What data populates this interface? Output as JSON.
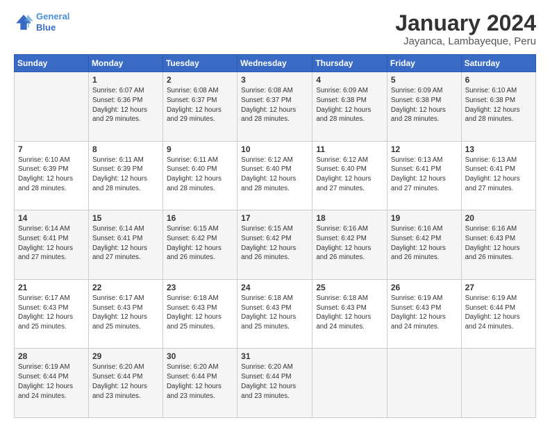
{
  "header": {
    "logo_line1": "General",
    "logo_line2": "Blue",
    "title": "January 2024",
    "subtitle": "Jayanca, Lambayeque, Peru"
  },
  "days_of_week": [
    "Sunday",
    "Monday",
    "Tuesday",
    "Wednesday",
    "Thursday",
    "Friday",
    "Saturday"
  ],
  "weeks": [
    [
      {
        "day": "",
        "info": ""
      },
      {
        "day": "1",
        "info": "Sunrise: 6:07 AM\nSunset: 6:36 PM\nDaylight: 12 hours\nand 29 minutes."
      },
      {
        "day": "2",
        "info": "Sunrise: 6:08 AM\nSunset: 6:37 PM\nDaylight: 12 hours\nand 29 minutes."
      },
      {
        "day": "3",
        "info": "Sunrise: 6:08 AM\nSunset: 6:37 PM\nDaylight: 12 hours\nand 28 minutes."
      },
      {
        "day": "4",
        "info": "Sunrise: 6:09 AM\nSunset: 6:38 PM\nDaylight: 12 hours\nand 28 minutes."
      },
      {
        "day": "5",
        "info": "Sunrise: 6:09 AM\nSunset: 6:38 PM\nDaylight: 12 hours\nand 28 minutes."
      },
      {
        "day": "6",
        "info": "Sunrise: 6:10 AM\nSunset: 6:38 PM\nDaylight: 12 hours\nand 28 minutes."
      }
    ],
    [
      {
        "day": "7",
        "info": "Sunrise: 6:10 AM\nSunset: 6:39 PM\nDaylight: 12 hours\nand 28 minutes."
      },
      {
        "day": "8",
        "info": "Sunrise: 6:11 AM\nSunset: 6:39 PM\nDaylight: 12 hours\nand 28 minutes."
      },
      {
        "day": "9",
        "info": "Sunrise: 6:11 AM\nSunset: 6:40 PM\nDaylight: 12 hours\nand 28 minutes."
      },
      {
        "day": "10",
        "info": "Sunrise: 6:12 AM\nSunset: 6:40 PM\nDaylight: 12 hours\nand 28 minutes."
      },
      {
        "day": "11",
        "info": "Sunrise: 6:12 AM\nSunset: 6:40 PM\nDaylight: 12 hours\nand 27 minutes."
      },
      {
        "day": "12",
        "info": "Sunrise: 6:13 AM\nSunset: 6:41 PM\nDaylight: 12 hours\nand 27 minutes."
      },
      {
        "day": "13",
        "info": "Sunrise: 6:13 AM\nSunset: 6:41 PM\nDaylight: 12 hours\nand 27 minutes."
      }
    ],
    [
      {
        "day": "14",
        "info": "Sunrise: 6:14 AM\nSunset: 6:41 PM\nDaylight: 12 hours\nand 27 minutes."
      },
      {
        "day": "15",
        "info": "Sunrise: 6:14 AM\nSunset: 6:41 PM\nDaylight: 12 hours\nand 27 minutes."
      },
      {
        "day": "16",
        "info": "Sunrise: 6:15 AM\nSunset: 6:42 PM\nDaylight: 12 hours\nand 26 minutes."
      },
      {
        "day": "17",
        "info": "Sunrise: 6:15 AM\nSunset: 6:42 PM\nDaylight: 12 hours\nand 26 minutes."
      },
      {
        "day": "18",
        "info": "Sunrise: 6:16 AM\nSunset: 6:42 PM\nDaylight: 12 hours\nand 26 minutes."
      },
      {
        "day": "19",
        "info": "Sunrise: 6:16 AM\nSunset: 6:42 PM\nDaylight: 12 hours\nand 26 minutes."
      },
      {
        "day": "20",
        "info": "Sunrise: 6:16 AM\nSunset: 6:43 PM\nDaylight: 12 hours\nand 26 minutes."
      }
    ],
    [
      {
        "day": "21",
        "info": "Sunrise: 6:17 AM\nSunset: 6:43 PM\nDaylight: 12 hours\nand 25 minutes."
      },
      {
        "day": "22",
        "info": "Sunrise: 6:17 AM\nSunset: 6:43 PM\nDaylight: 12 hours\nand 25 minutes."
      },
      {
        "day": "23",
        "info": "Sunrise: 6:18 AM\nSunset: 6:43 PM\nDaylight: 12 hours\nand 25 minutes."
      },
      {
        "day": "24",
        "info": "Sunrise: 6:18 AM\nSunset: 6:43 PM\nDaylight: 12 hours\nand 25 minutes."
      },
      {
        "day": "25",
        "info": "Sunrise: 6:18 AM\nSunset: 6:43 PM\nDaylight: 12 hours\nand 24 minutes."
      },
      {
        "day": "26",
        "info": "Sunrise: 6:19 AM\nSunset: 6:43 PM\nDaylight: 12 hours\nand 24 minutes."
      },
      {
        "day": "27",
        "info": "Sunrise: 6:19 AM\nSunset: 6:44 PM\nDaylight: 12 hours\nand 24 minutes."
      }
    ],
    [
      {
        "day": "28",
        "info": "Sunrise: 6:19 AM\nSunset: 6:44 PM\nDaylight: 12 hours\nand 24 minutes."
      },
      {
        "day": "29",
        "info": "Sunrise: 6:20 AM\nSunset: 6:44 PM\nDaylight: 12 hours\nand 23 minutes."
      },
      {
        "day": "30",
        "info": "Sunrise: 6:20 AM\nSunset: 6:44 PM\nDaylight: 12 hours\nand 23 minutes."
      },
      {
        "day": "31",
        "info": "Sunrise: 6:20 AM\nSunset: 6:44 PM\nDaylight: 12 hours\nand 23 minutes."
      },
      {
        "day": "",
        "info": ""
      },
      {
        "day": "",
        "info": ""
      },
      {
        "day": "",
        "info": ""
      }
    ]
  ]
}
